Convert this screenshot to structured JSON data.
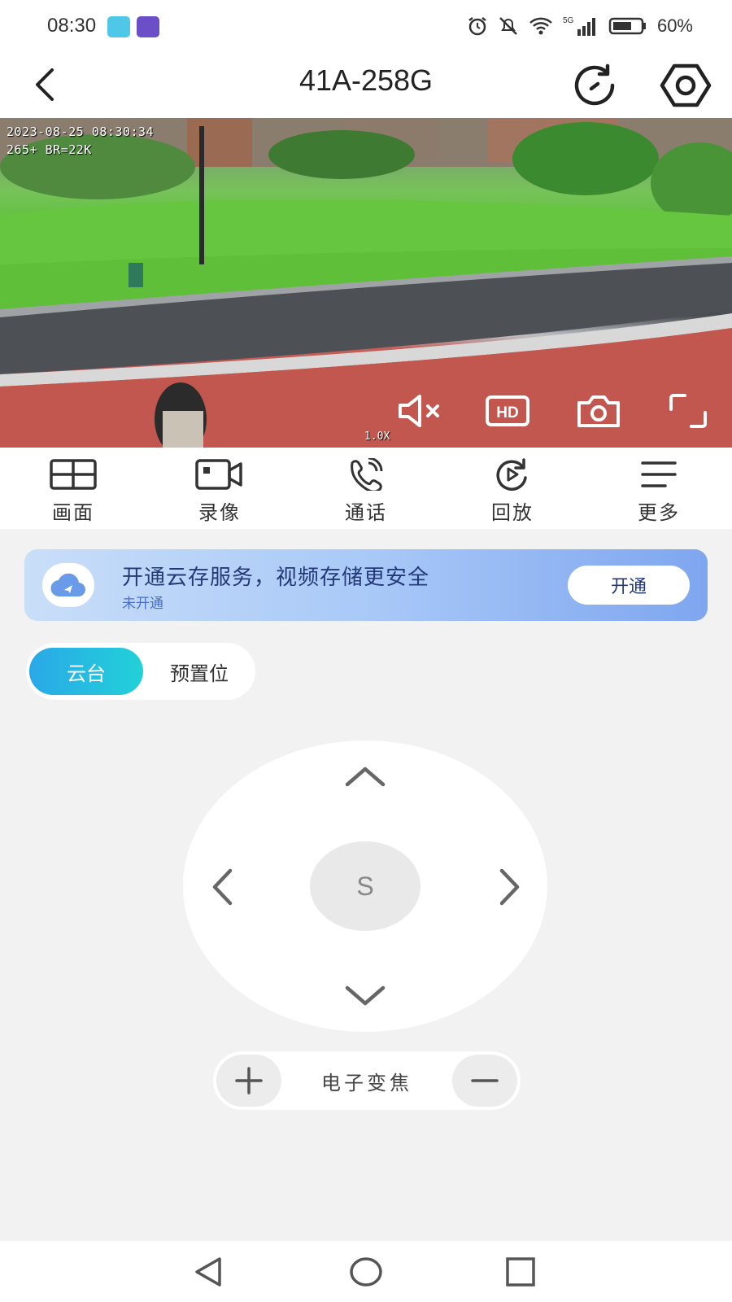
{
  "status_bar": {
    "time": "08:30",
    "battery": "60%",
    "icons": [
      "alarm-icon",
      "mute-icon",
      "wifi-icon",
      "signal-5g-icon",
      "battery-icon"
    ]
  },
  "header": {
    "title": "41A-258G",
    "icons": [
      "back-icon",
      "refresh-icon",
      "settings-icon"
    ]
  },
  "video": {
    "timestamp": "2023-08-25 08:30:34",
    "codec_line": "265+ BR=22K",
    "zoom": "1.0X",
    "controls": [
      "mute-icon",
      "hd-icon",
      "snapshot-icon",
      "fullscreen-icon"
    ]
  },
  "functions": [
    {
      "label": "画面",
      "icon": "grid-icon"
    },
    {
      "label": "录像",
      "icon": "video-record-icon"
    },
    {
      "label": "通话",
      "icon": "phone-icon"
    },
    {
      "label": "回放",
      "icon": "playback-icon"
    },
    {
      "label": "更多",
      "icon": "menu-icon"
    }
  ],
  "promo": {
    "title": "开通云存服务，视频存储更安全",
    "subtitle": "未开通",
    "button": "开通",
    "colors": {
      "start": "#c9def8",
      "end": "#7fa6ef",
      "text": "#243a78"
    }
  },
  "segment": {
    "active": "云台",
    "inactive": "预置位",
    "accent_start": "#2aa8e8",
    "accent_end": "#22d1d8"
  },
  "ptz": {
    "center_label": "S"
  },
  "zoom_control": {
    "label": "电子变焦"
  }
}
